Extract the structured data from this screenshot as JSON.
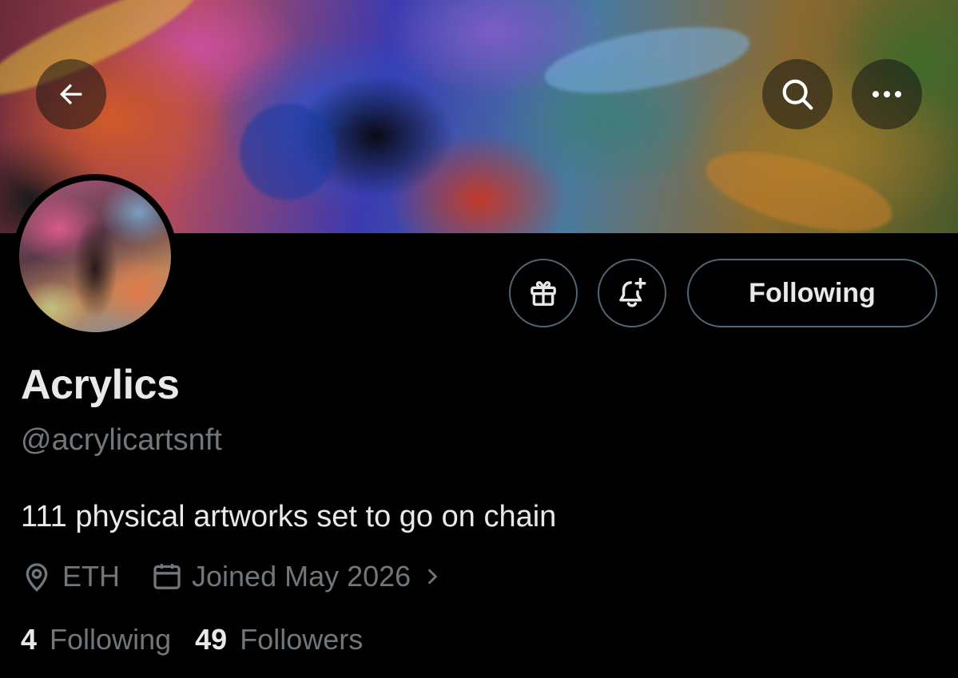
{
  "header": {
    "back_icon": "arrow-left-icon",
    "search_icon": "search-icon",
    "more_icon": "more-horizontal-icon"
  },
  "actions": {
    "gift_icon": "gift-icon",
    "notify_icon": "bell-plus-icon",
    "following_label": "Following"
  },
  "profile": {
    "name": "Acrylics",
    "handle": "@acrylicartsnft",
    "bio": "111 physical artworks set to go on chain",
    "location": "ETH",
    "joined": "Joined May 2026"
  },
  "stats": {
    "following_count": "4",
    "following_label": "Following",
    "followers_count": "49",
    "followers_label": "Followers"
  },
  "colors": {
    "background": "#000000",
    "text_primary": "#e7e9ea",
    "text_secondary": "#71767b",
    "border": "#536471"
  }
}
